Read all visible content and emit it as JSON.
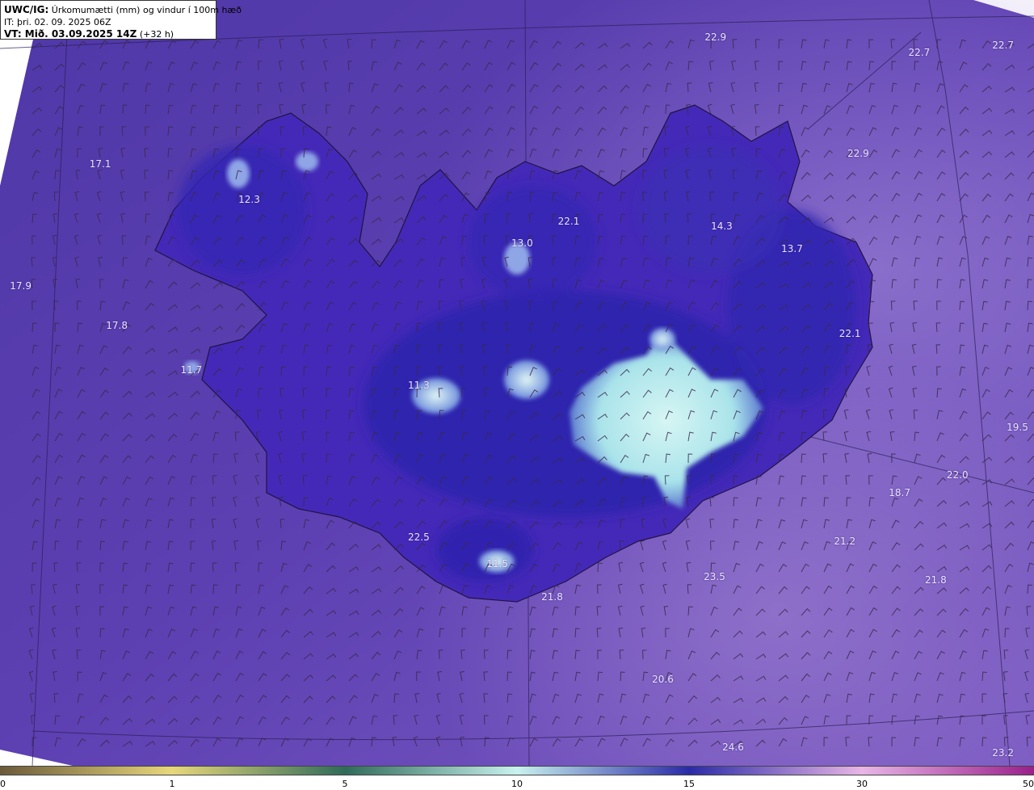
{
  "header": {
    "line1_bold": "UWC/IG:",
    "line1_rest": " Úrkomumætti (mm) og vindur í 100m hæð",
    "line2": "IT: þri. 02. 09. 2025 06Z",
    "line3_bold": "VT: Mið. 03.09.2025 14Z",
    "line3_rest": " (+32 h)"
  },
  "colors": {
    "ocean_base": "#5a3fb0",
    "ocean_light": "#8766c7",
    "land_base": "#4a2fb6",
    "highland_dark": "#2a21a8",
    "glacier": "#b9ecee",
    "coast": "#1f1440",
    "barb": "#3b2a4e"
  },
  "colorbar": {
    "stops": [
      {
        "label": "0",
        "color": "#6b5a3a"
      },
      {
        "label": "1",
        "color": "#e8d77a"
      },
      {
        "label": "5",
        "color": "#2f6b5a"
      },
      {
        "label": "10",
        "color": "#c8f2ee"
      },
      {
        "label": "15",
        "color": "#2a2aa8"
      },
      {
        "label": "30",
        "color": "#e8b6e6"
      },
      {
        "label": "50",
        "color": "#9a1f8c"
      }
    ]
  },
  "map_labels": [
    {
      "text": "22.9",
      "gx": 0.692,
      "gy": 0.049
    },
    {
      "text": "22.7",
      "gx": 0.889,
      "gy": 0.069
    },
    {
      "text": "22.7",
      "gx": 0.97,
      "gy": 0.059
    },
    {
      "text": "17.1",
      "gx": 0.097,
      "gy": 0.214
    },
    {
      "text": "22.9",
      "gx": 0.83,
      "gy": 0.2
    },
    {
      "text": "12.3",
      "gx": 0.241,
      "gy": 0.261
    },
    {
      "text": "22.1",
      "gx": 0.55,
      "gy": 0.289
    },
    {
      "text": "14.3",
      "gx": 0.698,
      "gy": 0.295
    },
    {
      "text": "13.0",
      "gx": 0.505,
      "gy": 0.317
    },
    {
      "text": "13.7",
      "gx": 0.766,
      "gy": 0.325
    },
    {
      "text": "17.9",
      "gx": 0.02,
      "gy": 0.373
    },
    {
      "text": "17.8",
      "gx": 0.113,
      "gy": 0.425
    },
    {
      "text": "22.1",
      "gx": 0.822,
      "gy": 0.436
    },
    {
      "text": "11.7",
      "gx": 0.185,
      "gy": 0.483
    },
    {
      "text": "11.3",
      "gx": 0.405,
      "gy": 0.503
    },
    {
      "text": "19.5",
      "gx": 0.984,
      "gy": 0.558
    },
    {
      "text": "22.0",
      "gx": 0.926,
      "gy": 0.62
    },
    {
      "text": "18.7",
      "gx": 0.87,
      "gy": 0.643
    },
    {
      "text": "22.5",
      "gx": 0.405,
      "gy": 0.702
    },
    {
      "text": "21.2",
      "gx": 0.817,
      "gy": 0.707
    },
    {
      "text": "11.5",
      "gx": 0.481,
      "gy": 0.736
    },
    {
      "text": "23.5",
      "gx": 0.691,
      "gy": 0.753
    },
    {
      "text": "21.8",
      "gx": 0.905,
      "gy": 0.757
    },
    {
      "text": "21.8",
      "gx": 0.534,
      "gy": 0.78
    },
    {
      "text": "20.6",
      "gx": 0.641,
      "gy": 0.887
    },
    {
      "text": "24.6",
      "gx": 0.709,
      "gy": 0.976
    },
    {
      "text": "23.2",
      "gx": 0.97,
      "gy": 0.983
    }
  ]
}
